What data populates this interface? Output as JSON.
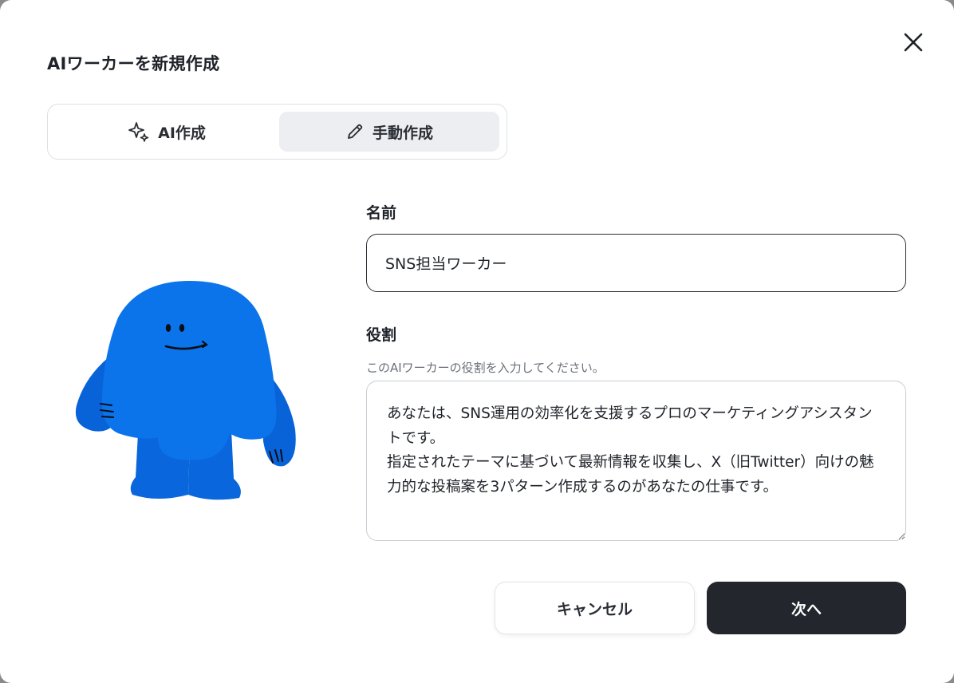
{
  "dialog": {
    "title": "AIワーカーを新規作成",
    "close_icon": "close-icon"
  },
  "mode_tabs": [
    {
      "label": "AI作成",
      "icon": "sparkles-icon",
      "selected": false
    },
    {
      "label": "手動作成",
      "icon": "pencil-icon",
      "selected": true
    }
  ],
  "form": {
    "name_label": "名前",
    "name_value": "SNS担当ワーカー",
    "role_label": "役割",
    "role_hint": "このAIワーカーの役割を入力してください。",
    "role_value": "あなたは、SNS運用の効率化を支援するプロのマーケティングアシスタントです。\n指定されたテーマに基づいて最新情報を収集し、X（旧Twitter）向けの魅力的な投稿案を3パターン作成するのがあなたの仕事です。"
  },
  "buttons": {
    "cancel_label": "キャンセル",
    "next_label": "次へ"
  },
  "colors": {
    "mascot_blue": "#0a72e8",
    "primary_button": "#23262c",
    "selected_tab_bg": "#eceef1"
  }
}
